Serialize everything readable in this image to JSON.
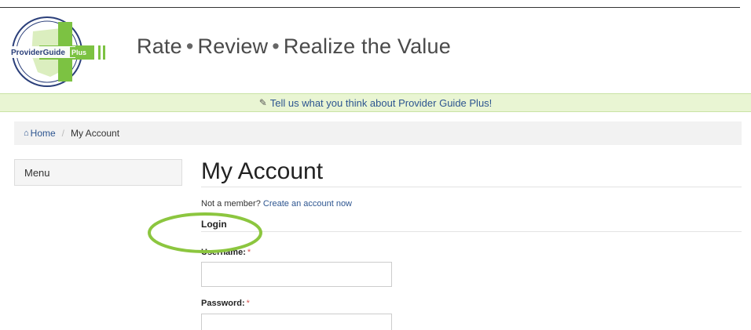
{
  "header": {
    "logo_text_main": "ProviderGuide",
    "logo_text_plus": "Plus",
    "tagline_parts": [
      "Rate",
      "Review",
      "Realize the Value"
    ],
    "tagline_separator": "•"
  },
  "feedback_bar": {
    "icon": "edit-icon",
    "text": "Tell us what you think about Provider Guide Plus!"
  },
  "breadcrumb": {
    "icon": "home-icon",
    "home_label": "Home",
    "separator": "/",
    "current_label": "My Account"
  },
  "sidebar": {
    "menu_label": "Menu"
  },
  "main": {
    "title": "My Account",
    "signup_prefix": "Not a member?",
    "signup_link": "Create an account now",
    "login_heading": "Login",
    "username_label": "Username:",
    "password_label": "Password:",
    "required_mark": "*",
    "username_value": "",
    "password_value": ""
  },
  "colors": {
    "feedback_bg": "#e9f5d3",
    "link": "#2d5590",
    "highlight_ring": "#8cc63f",
    "logo_plus_green": "#7cc242"
  }
}
